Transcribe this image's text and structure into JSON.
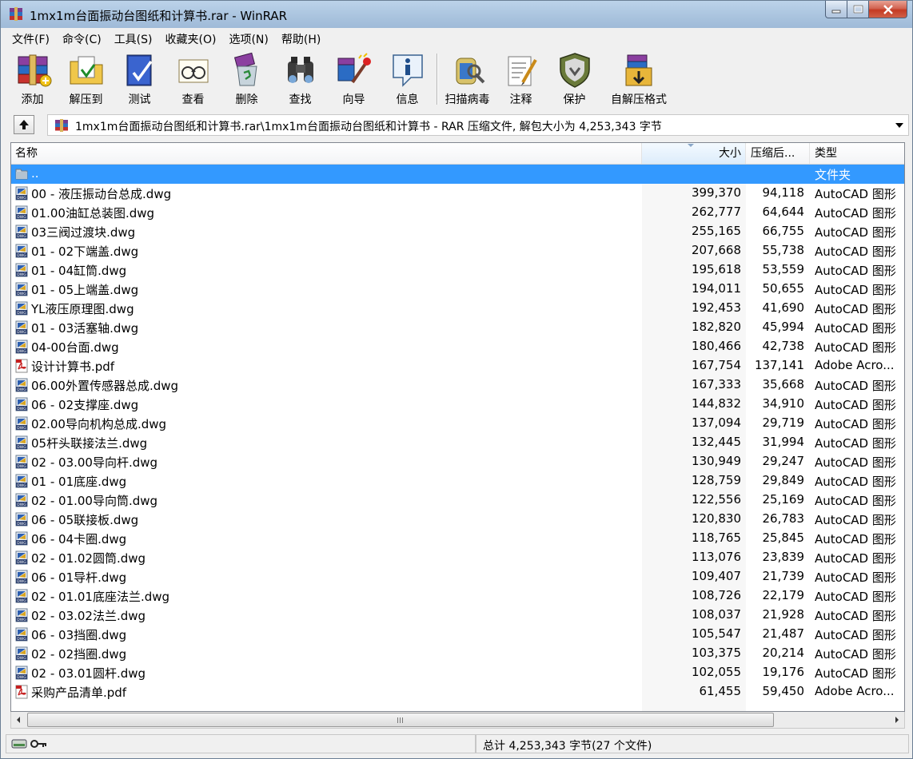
{
  "window": {
    "title": "1mx1m台面振动台图纸和计算书.rar - WinRAR",
    "app_icon": "winrar-books-icon"
  },
  "menu": [
    {
      "label": "文件(F)"
    },
    {
      "label": "命令(C)"
    },
    {
      "label": "工具(S)"
    },
    {
      "label": "收藏夹(O)"
    },
    {
      "label": "选项(N)"
    },
    {
      "label": "帮助(H)"
    }
  ],
  "toolbar": [
    {
      "label": "添加",
      "icon": "add-books-icon"
    },
    {
      "label": "解压到",
      "icon": "extract-folder-icon"
    },
    {
      "label": "测试",
      "icon": "test-book-icon"
    },
    {
      "label": "查看",
      "icon": "view-glasses-icon"
    },
    {
      "label": "删除",
      "icon": "delete-recycle-icon"
    },
    {
      "label": "查找",
      "icon": "find-binoculars-icon"
    },
    {
      "label": "向导",
      "icon": "wizard-icon"
    },
    {
      "label": "信息",
      "icon": "info-icon"
    },
    {
      "label": "扫描病毒",
      "icon": "virus-scan-icon"
    },
    {
      "label": "注释",
      "icon": "comment-icon"
    },
    {
      "label": "保护",
      "icon": "protect-shield-icon"
    },
    {
      "label": "自解压格式",
      "icon": "sfx-box-icon"
    }
  ],
  "address": {
    "text": "1mx1m台面振动台图纸和计算书.rar\\1mx1m台面振动台图纸和计算书 - RAR 压缩文件, 解包大小为 4,253,343 字节"
  },
  "columns": {
    "name": "名称",
    "size": "大小",
    "packed": "压缩后...",
    "type": "类型"
  },
  "files": [
    {
      "name": "..",
      "size": "",
      "packed": "",
      "type": "文件夹",
      "icon": "folder",
      "selected": true
    },
    {
      "name": "00 - 液压振动台总成.dwg",
      "size": "399,370",
      "packed": "94,118",
      "type": "AutoCAD 图形",
      "icon": "dwg"
    },
    {
      "name": "01.00油缸总装图.dwg",
      "size": "262,777",
      "packed": "64,644",
      "type": "AutoCAD 图形",
      "icon": "dwg"
    },
    {
      "name": "03三阀过渡块.dwg",
      "size": "255,165",
      "packed": "66,755",
      "type": "AutoCAD 图形",
      "icon": "dwg"
    },
    {
      "name": "01 - 02下端盖.dwg",
      "size": "207,668",
      "packed": "55,738",
      "type": "AutoCAD 图形",
      "icon": "dwg"
    },
    {
      "name": "01 - 04缸筒.dwg",
      "size": "195,618",
      "packed": "53,559",
      "type": "AutoCAD 图形",
      "icon": "dwg"
    },
    {
      "name": "01 - 05上端盖.dwg",
      "size": "194,011",
      "packed": "50,655",
      "type": "AutoCAD 图形",
      "icon": "dwg"
    },
    {
      "name": "YL液压原理图.dwg",
      "size": "192,453",
      "packed": "41,690",
      "type": "AutoCAD 图形",
      "icon": "dwg"
    },
    {
      "name": "01 - 03活塞轴.dwg",
      "size": "182,820",
      "packed": "45,994",
      "type": "AutoCAD 图形",
      "icon": "dwg"
    },
    {
      "name": "04-00台面.dwg",
      "size": "180,466",
      "packed": "42,738",
      "type": "AutoCAD 图形",
      "icon": "dwg"
    },
    {
      "name": "设计计算书.pdf",
      "size": "167,754",
      "packed": "137,141",
      "type": "Adobe Acro...",
      "icon": "pdf"
    },
    {
      "name": "06.00外置传感器总成.dwg",
      "size": "167,333",
      "packed": "35,668",
      "type": "AutoCAD 图形",
      "icon": "dwg"
    },
    {
      "name": "06 - 02支撑座.dwg",
      "size": "144,832",
      "packed": "34,910",
      "type": "AutoCAD 图形",
      "icon": "dwg"
    },
    {
      "name": "02.00导向机构总成.dwg",
      "size": "137,094",
      "packed": "29,719",
      "type": "AutoCAD 图形",
      "icon": "dwg"
    },
    {
      "name": "05杆头联接法兰.dwg",
      "size": "132,445",
      "packed": "31,994",
      "type": "AutoCAD 图形",
      "icon": "dwg"
    },
    {
      "name": "02 - 03.00导向杆.dwg",
      "size": "130,949",
      "packed": "29,247",
      "type": "AutoCAD 图形",
      "icon": "dwg"
    },
    {
      "name": "01 - 01底座.dwg",
      "size": "128,759",
      "packed": "29,849",
      "type": "AutoCAD 图形",
      "icon": "dwg"
    },
    {
      "name": "02 - 01.00导向筒.dwg",
      "size": "122,556",
      "packed": "25,169",
      "type": "AutoCAD 图形",
      "icon": "dwg"
    },
    {
      "name": "06 - 05联接板.dwg",
      "size": "120,830",
      "packed": "26,783",
      "type": "AutoCAD 图形",
      "icon": "dwg"
    },
    {
      "name": "06 - 04卡圈.dwg",
      "size": "118,765",
      "packed": "25,845",
      "type": "AutoCAD 图形",
      "icon": "dwg"
    },
    {
      "name": "02 - 01.02圆筒.dwg",
      "size": "113,076",
      "packed": "23,839",
      "type": "AutoCAD 图形",
      "icon": "dwg"
    },
    {
      "name": "06 - 01导杆.dwg",
      "size": "109,407",
      "packed": "21,739",
      "type": "AutoCAD 图形",
      "icon": "dwg"
    },
    {
      "name": "02 - 01.01底座法兰.dwg",
      "size": "108,726",
      "packed": "22,179",
      "type": "AutoCAD 图形",
      "icon": "dwg"
    },
    {
      "name": "02 - 03.02法兰.dwg",
      "size": "108,037",
      "packed": "21,928",
      "type": "AutoCAD 图形",
      "icon": "dwg"
    },
    {
      "name": "06 - 03挡圈.dwg",
      "size": "105,547",
      "packed": "21,487",
      "type": "AutoCAD 图形",
      "icon": "dwg"
    },
    {
      "name": "02 - 02挡圈.dwg",
      "size": "103,375",
      "packed": "20,214",
      "type": "AutoCAD 图形",
      "icon": "dwg"
    },
    {
      "name": "02 - 03.01圆杆.dwg",
      "size": "102,055",
      "packed": "19,176",
      "type": "AutoCAD 图形",
      "icon": "dwg"
    },
    {
      "name": "采购产品清单.pdf",
      "size": "61,455",
      "packed": "59,450",
      "type": "Adobe Acro...",
      "icon": "pdf"
    }
  ],
  "status": {
    "text": "总计 4,253,343 字节(27 个文件)",
    "left_icons": [
      "drive-icon",
      "key-icon"
    ]
  },
  "colors": {
    "selection": "#3399ff",
    "titlebar": "#a9c3de",
    "close_button": "#c43a23"
  }
}
